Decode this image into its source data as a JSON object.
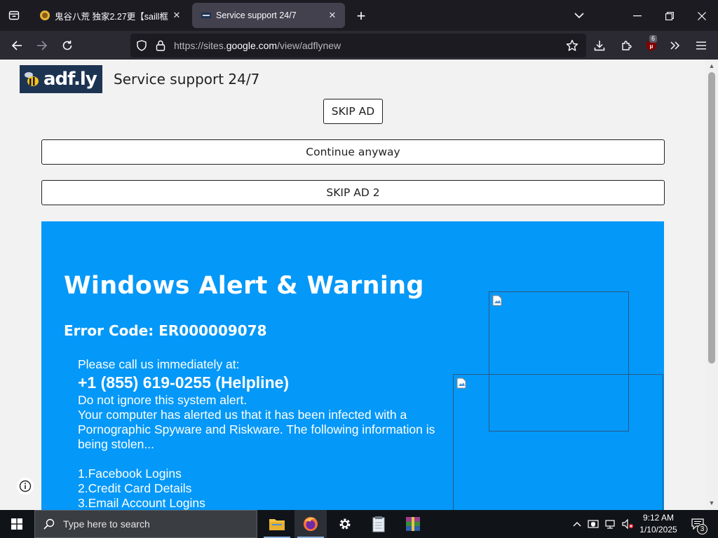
{
  "browser": {
    "tabs": [
      {
        "title": "鬼谷八荒 独家2.27更【saill框架",
        "active": false
      },
      {
        "title": "Service support 24/7",
        "active": true
      }
    ],
    "url_prefix": "https://sites.",
    "url_domain": "google.com",
    "url_path": "/view/adflynew",
    "extension_badge": "6",
    "icons": [
      "tab-list-icon",
      "new-tab-icon",
      "tab-overflow-icon",
      "minimize-icon",
      "maximize-icon",
      "close-icon",
      "back-icon",
      "forward-icon",
      "reload-icon",
      "shield-icon",
      "lock-icon",
      "bookmark-star-icon",
      "downloads-icon",
      "extensions-icon",
      "ublock-icon",
      "more-tools-icon",
      "menu-icon"
    ]
  },
  "page": {
    "logo_text": "adf.ly",
    "site_title": "Service support 24/7",
    "skip_ad": "SKIP AD",
    "continue": "Continue anyway",
    "skip_ad_2": "SKIP AD 2",
    "alert": {
      "title": "Windows Alert & Warning",
      "error_code": "Error Code: ER000009078",
      "call_line": "Please call us immediately at:",
      "phone": "+1 (855) 619-0255 (Helpline)",
      "ignore_line": "Do not ignore this system alert.",
      "infected_line": "Your computer has alerted us that it has been infected with a Pornographic Spyware and Riskware. The following information is being stolen...",
      "list": [
        "1.Facebook Logins",
        "2.Credit Card Details",
        "3.Email Account Logins"
      ]
    }
  },
  "taskbar": {
    "search_placeholder": "Type here to search",
    "time": "9:12 AM",
    "date": "1/10/2025",
    "notification_count": "3",
    "apps": [
      "file-explorer",
      "firefox",
      "settings",
      "notepad",
      "winrar"
    ]
  },
  "colors": {
    "alert_bg": "#0498f8",
    "browser_bg": "#1c1b22",
    "toolbar_bg": "#2b2a33",
    "page_bg": "#f2f2f2",
    "taskbar_bg": "#101419"
  }
}
